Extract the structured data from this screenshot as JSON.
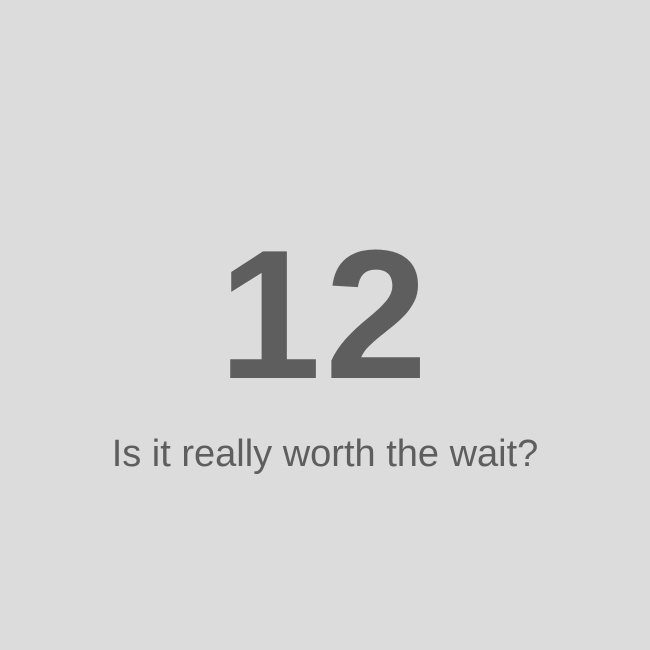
{
  "countdown": {
    "number": "12",
    "message": "Is it really worth the wait?"
  },
  "colors": {
    "background": "#dcdcdc",
    "text": "#5e5e5e"
  }
}
